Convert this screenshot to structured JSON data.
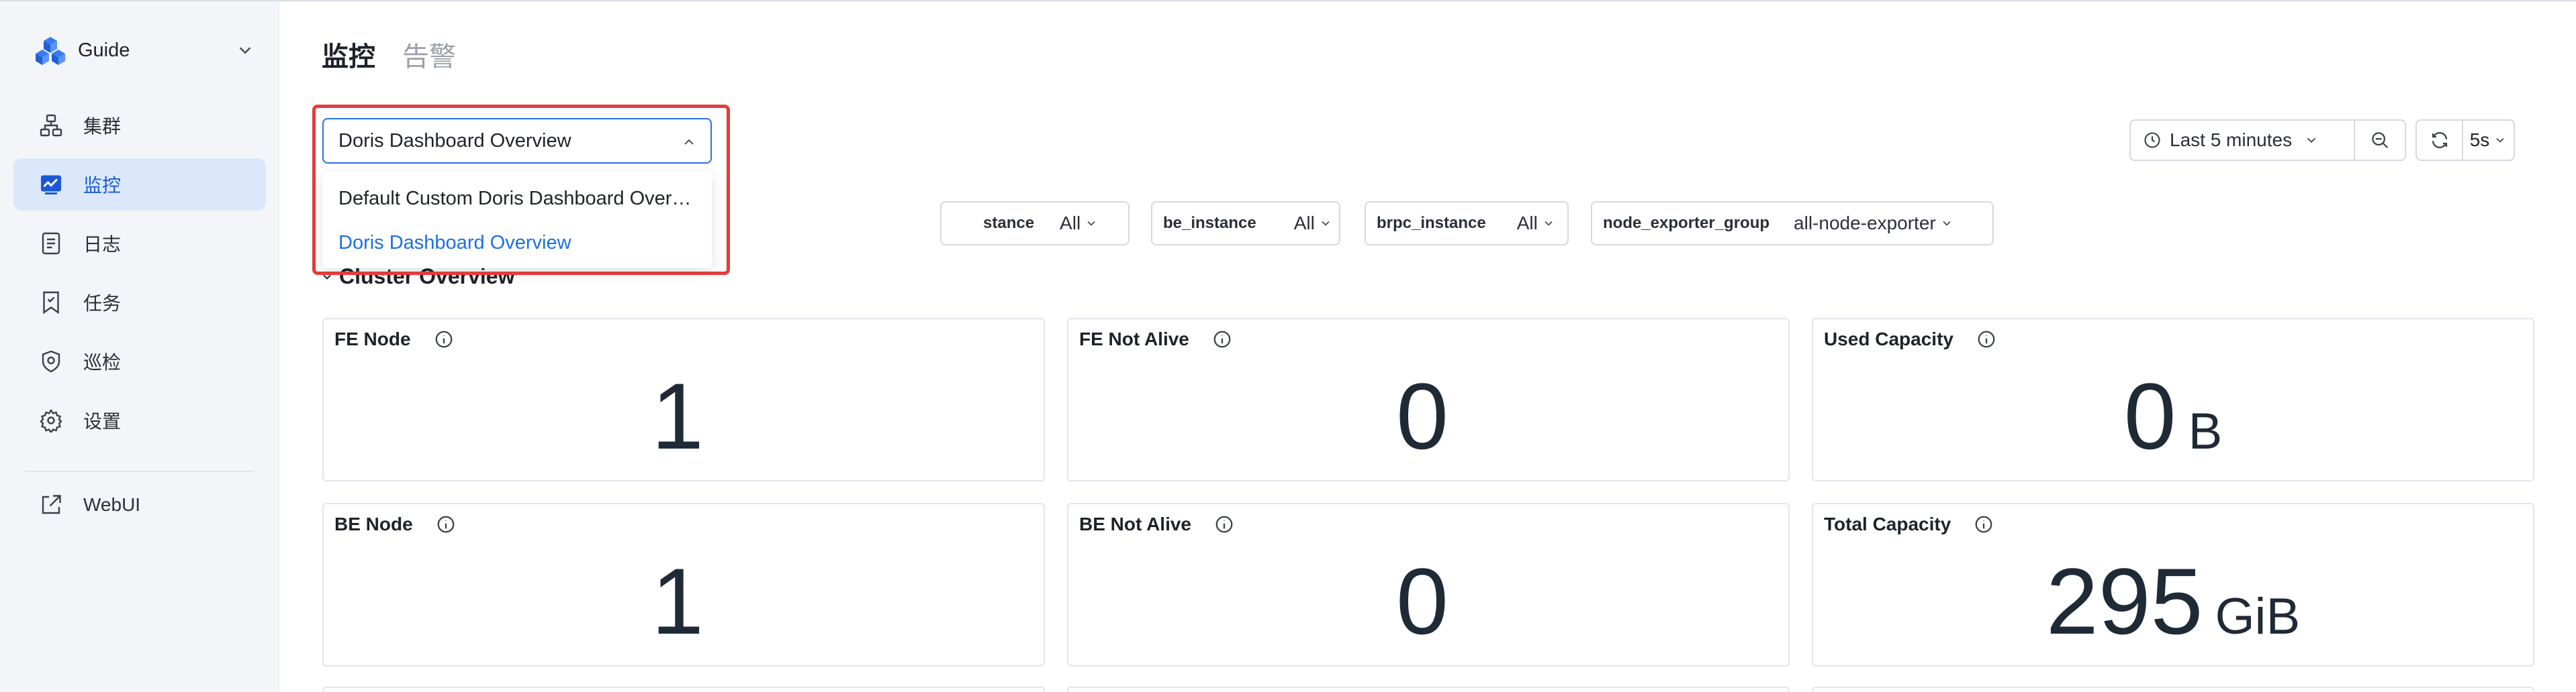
{
  "sidebar": {
    "brand": "Guide",
    "items": [
      {
        "label": "集群",
        "icon": "cluster-icon"
      },
      {
        "label": "监控",
        "icon": "monitor-chart-icon",
        "active": true
      },
      {
        "label": "日志",
        "icon": "log-document-icon"
      },
      {
        "label": "任务",
        "icon": "task-bookmark-icon"
      },
      {
        "label": "巡检",
        "icon": "inspection-shield-icon"
      },
      {
        "label": "设置",
        "icon": "gear-icon"
      },
      {
        "label": "WebUI",
        "icon": "external-link-icon"
      }
    ]
  },
  "tabs": [
    "监控",
    "告警"
  ],
  "dashboard_select": {
    "value": "Doris Dashboard Overview",
    "options": [
      "Default Custom Doris Dashboard Over…",
      "Doris Dashboard Overview"
    ],
    "selected_option": "Doris Dashboard Overview"
  },
  "toolbar": {
    "time_range": "Last 5 minutes",
    "refresh_interval": "5s"
  },
  "variables": [
    {
      "name": "stance",
      "value": "All"
    },
    {
      "name": "be_instance",
      "value": "All"
    },
    {
      "name": "brpc_instance",
      "value": "All"
    },
    {
      "name": "node_exporter_group",
      "value": "all-node-exporter"
    }
  ],
  "section_title": "Cluster Overview",
  "panels": [
    {
      "title": "FE Node",
      "value": "1",
      "unit": ""
    },
    {
      "title": "FE Not Alive",
      "value": "0",
      "unit": ""
    },
    {
      "title": "Used Capacity",
      "value": "0",
      "unit": "B"
    },
    {
      "title": "BE Node",
      "value": "1",
      "unit": ""
    },
    {
      "title": "BE Not Alive",
      "value": "0",
      "unit": ""
    },
    {
      "title": "Total Capacity",
      "value": "295",
      "unit": "GiB"
    }
  ],
  "colors": {
    "accent": "#1a6fe6",
    "highlight": "#e63a3a",
    "sidebar_bg": "#f3f5f8",
    "active_bg": "#dbe8fb"
  }
}
